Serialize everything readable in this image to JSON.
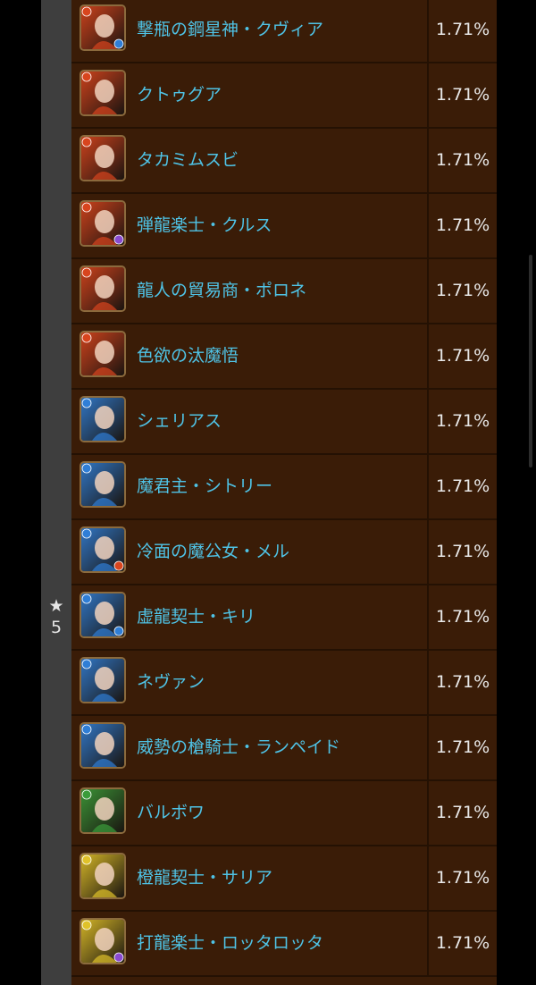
{
  "star_label": {
    "icon": "★",
    "value": "5"
  },
  "colors": {
    "fire": "#d8451e",
    "water": "#2f7ed6",
    "wood": "#3a9c3a",
    "light": "#e0c22a",
    "dark": "#8a4bd0",
    "name": "#4fc3e6"
  },
  "rows": [
    {
      "name": "撃瓶の鋼星神・クヴィア",
      "rate": "1.71%",
      "attr": "fire",
      "sub": "water"
    },
    {
      "name": "クトゥグア",
      "rate": "1.71%",
      "attr": "fire",
      "sub": ""
    },
    {
      "name": "タカミムスビ",
      "rate": "1.71%",
      "attr": "fire",
      "sub": ""
    },
    {
      "name": "弾龍楽士・クルス",
      "rate": "1.71%",
      "attr": "fire",
      "sub": "dark"
    },
    {
      "name": "龍人の貿易商・ポロネ",
      "rate": "1.71%",
      "attr": "fire",
      "sub": ""
    },
    {
      "name": "色欲の汰魔悟",
      "rate": "1.71%",
      "attr": "fire",
      "sub": ""
    },
    {
      "name": "シェリアス",
      "rate": "1.71%",
      "attr": "water",
      "sub": ""
    },
    {
      "name": "魔君主・シトリー",
      "rate": "1.71%",
      "attr": "water",
      "sub": ""
    },
    {
      "name": "冷面の魔公女・メル",
      "rate": "1.71%",
      "attr": "water",
      "sub": "fire"
    },
    {
      "name": "虚龍契士・キリ",
      "rate": "1.71%",
      "attr": "water",
      "sub": "water"
    },
    {
      "name": "ネヴァン",
      "rate": "1.71%",
      "attr": "water",
      "sub": ""
    },
    {
      "name": "威勢の槍騎士・ランペイド",
      "rate": "1.71%",
      "attr": "water",
      "sub": ""
    },
    {
      "name": "バルボワ",
      "rate": "1.71%",
      "attr": "wood",
      "sub": ""
    },
    {
      "name": "橙龍契士・サリア",
      "rate": "1.71%",
      "attr": "light",
      "sub": ""
    },
    {
      "name": "打龍楽士・ロッタロッタ",
      "rate": "1.71%",
      "attr": "light",
      "sub": "dark"
    }
  ]
}
